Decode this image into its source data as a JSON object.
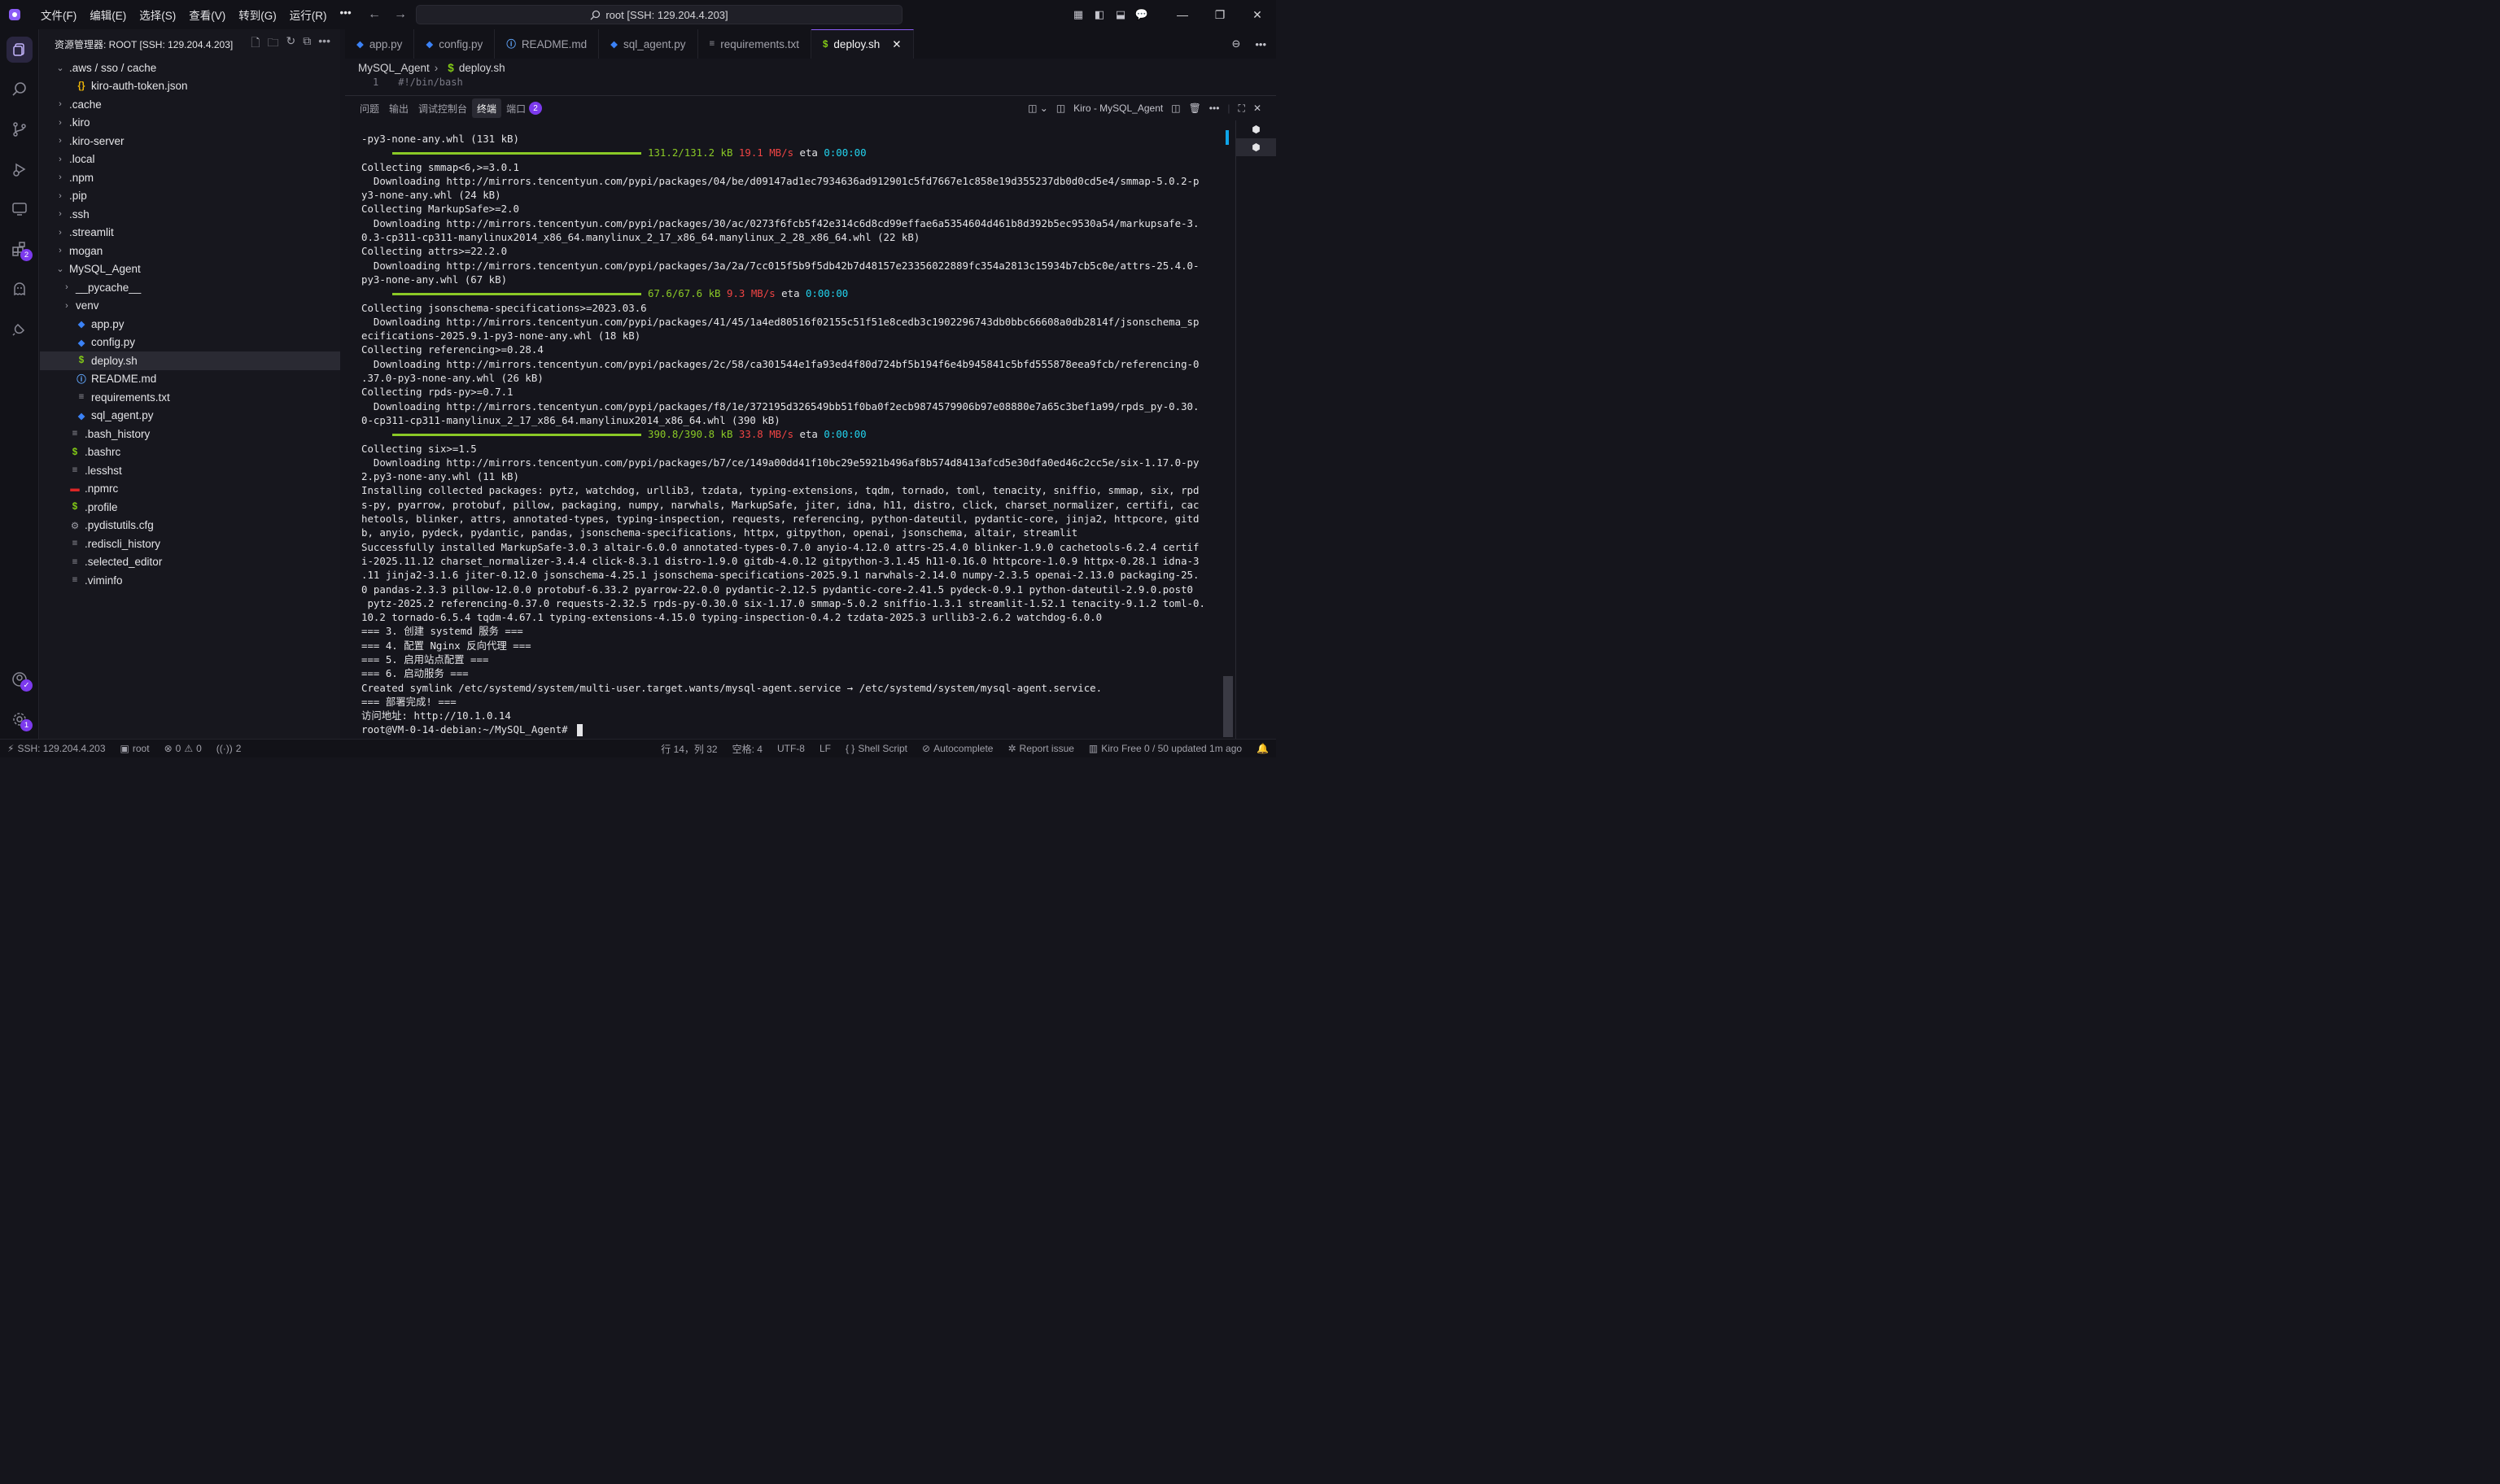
{
  "titlebar": {
    "menu": [
      "文件(F)",
      "编辑(E)",
      "选择(S)",
      "查看(V)",
      "转到(G)",
      "运行(R)"
    ],
    "more": "•••",
    "search_text": "root [SSH: 129.204.4.203]"
  },
  "activity_badges": {
    "extensions": "2",
    "settings": "1"
  },
  "sidebar": {
    "title": "资源管理器: ROOT [SSH: 129.204.4.203]",
    "items": [
      {
        "label": ".aws / sso / cache",
        "indent": 0,
        "chev": "⌄",
        "icon": "",
        "color": "#a1a1aa"
      },
      {
        "label": "kiro-auth-token.json",
        "indent": 1,
        "chev": "",
        "icon": "{}",
        "color": "#eab308"
      },
      {
        "label": ".cache",
        "indent": 0,
        "chev": "›",
        "icon": "",
        "color": "#a1a1aa"
      },
      {
        "label": ".kiro",
        "indent": 0,
        "chev": "›",
        "icon": "",
        "color": "#a1a1aa"
      },
      {
        "label": ".kiro-server",
        "indent": 0,
        "chev": "›",
        "icon": "",
        "color": "#a1a1aa"
      },
      {
        "label": ".local",
        "indent": 0,
        "chev": "›",
        "icon": "",
        "color": "#a1a1aa"
      },
      {
        "label": ".npm",
        "indent": 0,
        "chev": "›",
        "icon": "",
        "color": "#a1a1aa"
      },
      {
        "label": ".pip",
        "indent": 0,
        "chev": "›",
        "icon": "",
        "color": "#a1a1aa"
      },
      {
        "label": ".ssh",
        "indent": 0,
        "chev": "›",
        "icon": "",
        "color": "#a1a1aa"
      },
      {
        "label": ".streamlit",
        "indent": 0,
        "chev": "›",
        "icon": "",
        "color": "#a1a1aa"
      },
      {
        "label": "mogan",
        "indent": 0,
        "chev": "›",
        "icon": "",
        "color": "#a1a1aa"
      },
      {
        "label": "MySQL_Agent",
        "indent": 0,
        "chev": "⌄",
        "icon": "",
        "color": "#a1a1aa"
      },
      {
        "label": "__pycache__",
        "indent": 1,
        "chev": "›",
        "icon": "",
        "color": "#a1a1aa"
      },
      {
        "label": "venv",
        "indent": 1,
        "chev": "›",
        "icon": "",
        "color": "#a1a1aa"
      },
      {
        "label": "app.py",
        "indent": 1,
        "chev": "",
        "icon": "◆",
        "color": "#3b82f6"
      },
      {
        "label": "config.py",
        "indent": 1,
        "chev": "",
        "icon": "◆",
        "color": "#3b82f6"
      },
      {
        "label": "deploy.sh",
        "indent": 1,
        "chev": "",
        "icon": "$",
        "color": "#84cc16",
        "selected": true
      },
      {
        "label": "README.md",
        "indent": 1,
        "chev": "",
        "icon": "ⓘ",
        "color": "#60a5fa"
      },
      {
        "label": "requirements.txt",
        "indent": 1,
        "chev": "",
        "icon": "≡",
        "color": "#a1a1aa"
      },
      {
        "label": "sql_agent.py",
        "indent": 1,
        "chev": "",
        "icon": "◆",
        "color": "#3b82f6"
      },
      {
        "label": ".bash_history",
        "indent": 0,
        "chev": "",
        "icon": "≡",
        "color": "#a1a1aa"
      },
      {
        "label": ".bashrc",
        "indent": 0,
        "chev": "",
        "icon": "$",
        "color": "#84cc16"
      },
      {
        "label": ".lesshst",
        "indent": 0,
        "chev": "",
        "icon": "≡",
        "color": "#a1a1aa"
      },
      {
        "label": ".npmrc",
        "indent": 0,
        "chev": "",
        "icon": "▬",
        "color": "#dc2626"
      },
      {
        "label": ".profile",
        "indent": 0,
        "chev": "",
        "icon": "$",
        "color": "#84cc16"
      },
      {
        "label": ".pydistutils.cfg",
        "indent": 0,
        "chev": "",
        "icon": "⚙",
        "color": "#a1a1aa"
      },
      {
        "label": ".rediscli_history",
        "indent": 0,
        "chev": "",
        "icon": "≡",
        "color": "#a1a1aa"
      },
      {
        "label": ".selected_editor",
        "indent": 0,
        "chev": "",
        "icon": "≡",
        "color": "#a1a1aa"
      },
      {
        "label": ".viminfo",
        "indent": 0,
        "chev": "",
        "icon": "≡",
        "color": "#a1a1aa"
      }
    ]
  },
  "tabs": [
    {
      "label": "app.py",
      "icon": "◆",
      "color": "#3b82f6"
    },
    {
      "label": "config.py",
      "icon": "◆",
      "color": "#3b82f6"
    },
    {
      "label": "README.md",
      "icon": "ⓘ",
      "color": "#60a5fa"
    },
    {
      "label": "sql_agent.py",
      "icon": "◆",
      "color": "#3b82f6"
    },
    {
      "label": "requirements.txt",
      "icon": "≡",
      "color": "#a1a1aa"
    },
    {
      "label": "deploy.sh",
      "icon": "$",
      "color": "#84cc16",
      "active": true
    }
  ],
  "breadcrumb": {
    "folder": "MySQL_Agent",
    "file": "deploy.sh"
  },
  "editor": {
    "line_no": "1",
    "code": "#!/bin/bash"
  },
  "panel": {
    "tabs": [
      "问题",
      "输出",
      "调试控制台",
      "终端",
      "端口"
    ],
    "ports_badge": "2",
    "terminal_name": "Kiro - MySQL_Agent"
  },
  "terminal": {
    "lines": [
      {
        "t": "-py3-none-any.whl (131 kB)"
      },
      {
        "progress": true,
        "amount": "131.2/131.2 kB",
        "speed": "19.1 MB/s",
        "eta_label": "eta",
        "eta": "0:00:00"
      },
      {
        "t": "Collecting smmap<6,>=3.0.1"
      },
      {
        "t": "  Downloading http://mirrors.tencentyun.com/pypi/packages/04/be/d09147ad1ec7934636ad912901c5fd7667e1c858e19d355237db0d0cd5e4/smmap-5.0.2-p"
      },
      {
        "t": "y3-none-any.whl (24 kB)"
      },
      {
        "t": "Collecting MarkupSafe>=2.0"
      },
      {
        "t": "  Downloading http://mirrors.tencentyun.com/pypi/packages/30/ac/0273f6fcb5f42e314c6d8cd99effae6a5354604d461b8d392b5ec9530a54/markupsafe-3."
      },
      {
        "t": "0.3-cp311-cp311-manylinux2014_x86_64.manylinux_2_17_x86_64.manylinux_2_28_x86_64.whl (22 kB)"
      },
      {
        "t": "Collecting attrs>=22.2.0"
      },
      {
        "t": "  Downloading http://mirrors.tencentyun.com/pypi/packages/3a/2a/7cc015f5b9f5db42b7d48157e23356022889fc354a2813c15934b7cb5c0e/attrs-25.4.0-"
      },
      {
        "t": "py3-none-any.whl (67 kB)"
      },
      {
        "progress": true,
        "amount": "67.6/67.6 kB",
        "speed": "9.3 MB/s",
        "eta_label": "eta",
        "eta": "0:00:00"
      },
      {
        "t": "Collecting jsonschema-specifications>=2023.03.6"
      },
      {
        "t": "  Downloading http://mirrors.tencentyun.com/pypi/packages/41/45/1a4ed80516f02155c51f51e8cedb3c1902296743db0bbc66608a0db2814f/jsonschema_sp"
      },
      {
        "t": "ecifications-2025.9.1-py3-none-any.whl (18 kB)"
      },
      {
        "t": "Collecting referencing>=0.28.4"
      },
      {
        "t": "  Downloading http://mirrors.tencentyun.com/pypi/packages/2c/58/ca301544e1fa93ed4f80d724bf5b194f6e4b945841c5bfd555878eea9fcb/referencing-0"
      },
      {
        "t": ".37.0-py3-none-any.whl (26 kB)"
      },
      {
        "t": "Collecting rpds-py>=0.7.1"
      },
      {
        "t": "  Downloading http://mirrors.tencentyun.com/pypi/packages/f8/1e/372195d326549bb51f0ba0f2ecb9874579906b97e08880e7a65c3bef1a99/rpds_py-0.30."
      },
      {
        "t": "0-cp311-cp311-manylinux_2_17_x86_64.manylinux2014_x86_64.whl (390 kB)"
      },
      {
        "progress": true,
        "amount": "390.8/390.8 kB",
        "speed": "33.8 MB/s",
        "eta_label": "eta",
        "eta": "0:00:00"
      },
      {
        "t": "Collecting six>=1.5"
      },
      {
        "t": "  Downloading http://mirrors.tencentyun.com/pypi/packages/b7/ce/149a00dd41f10bc29e5921b496af8b574d8413afcd5e30dfa0ed46c2cc5e/six-1.17.0-py"
      },
      {
        "t": "2.py3-none-any.whl (11 kB)"
      },
      {
        "t": "Installing collected packages: pytz, watchdog, urllib3, tzdata, typing-extensions, tqdm, tornado, toml, tenacity, sniffio, smmap, six, rpd"
      },
      {
        "t": "s-py, pyarrow, protobuf, pillow, packaging, numpy, narwhals, MarkupSafe, jiter, idna, h11, distro, click, charset_normalizer, certifi, cac"
      },
      {
        "t": "hetools, blinker, attrs, annotated-types, typing-inspection, requests, referencing, python-dateutil, pydantic-core, jinja2, httpcore, gitd"
      },
      {
        "t": "b, anyio, pydeck, pydantic, pandas, jsonschema-specifications, httpx, gitpython, openai, jsonschema, altair, streamlit"
      },
      {
        "t": "Successfully installed MarkupSafe-3.0.3 altair-6.0.0 annotated-types-0.7.0 anyio-4.12.0 attrs-25.4.0 blinker-1.9.0 cachetools-6.2.4 certif"
      },
      {
        "t": "i-2025.11.12 charset_normalizer-3.4.4 click-8.3.1 distro-1.9.0 gitdb-4.0.12 gitpython-3.1.45 h11-0.16.0 httpcore-1.0.9 httpx-0.28.1 idna-3"
      },
      {
        "t": ".11 jinja2-3.1.6 jiter-0.12.0 jsonschema-4.25.1 jsonschema-specifications-2025.9.1 narwhals-2.14.0 numpy-2.3.5 openai-2.13.0 packaging-25."
      },
      {
        "t": "0 pandas-2.3.3 pillow-12.0.0 protobuf-6.33.2 pyarrow-22.0.0 pydantic-2.12.5 pydantic-core-2.41.5 pydeck-0.9.1 python-dateutil-2.9.0.post0"
      },
      {
        "t": " pytz-2025.2 referencing-0.37.0 requests-2.32.5 rpds-py-0.30.0 six-1.17.0 smmap-5.0.2 sniffio-1.3.1 streamlit-1.52.1 tenacity-9.1.2 toml-0."
      },
      {
        "t": "10.2 tornado-6.5.4 tqdm-4.67.1 typing-extensions-4.15.0 typing-inspection-0.4.2 tzdata-2025.3 urllib3-2.6.2 watchdog-6.0.0"
      },
      {
        "t": "=== 3. 创建 systemd 服务 ==="
      },
      {
        "t": "=== 4. 配置 Nginx 反向代理 ==="
      },
      {
        "t": "=== 5. 启用站点配置 ==="
      },
      {
        "t": "=== 6. 启动服务 ==="
      },
      {
        "t": "Created symlink /etc/systemd/system/multi-user.target.wants/mysql-agent.service → /etc/systemd/system/mysql-agent.service."
      },
      {
        "t": "=== 部署完成! ==="
      },
      {
        "t": "访问地址: http://10.1.0.14"
      },
      {
        "prompt": true,
        "t": "root@VM-0-14-debian:~/MySQL_Agent# "
      }
    ]
  },
  "statusbar": {
    "ssh": "SSH: 129.204.4.203",
    "user": "root",
    "errors": "0",
    "warnings": "0",
    "ports": "2",
    "position": "行 14，列 32",
    "spaces": "空格: 4",
    "encoding": "UTF-8",
    "eol": "LF",
    "language": "Shell Script",
    "autocomplete": "Autocomplete",
    "report": "Report issue",
    "plan": "Kiro Free 0 / 50 updated 1m ago"
  },
  "colors": {
    "accent": "#8b5cf6",
    "progress": "#8ac926",
    "speed": "#ef4444",
    "eta": "#22d3ee"
  }
}
